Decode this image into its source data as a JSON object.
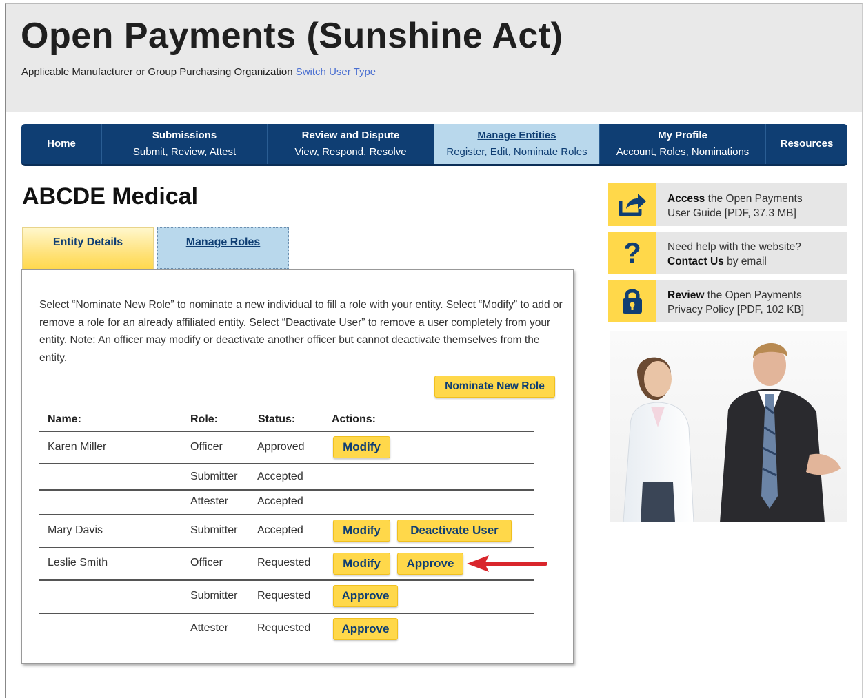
{
  "header": {
    "title": "Open Payments (Sunshine Act)",
    "user_type": "Applicable Manufacturer or Group Purchasing Organization",
    "switch_link": "Switch User Type"
  },
  "nav": [
    {
      "title": "Home",
      "subtitle": ""
    },
    {
      "title": "Submissions",
      "subtitle": "Submit, Review, Attest"
    },
    {
      "title": "Review and Dispute",
      "subtitle": "View, Respond, Resolve"
    },
    {
      "title": "Manage Entities",
      "subtitle": "Register, Edit, Nominate Roles"
    },
    {
      "title": "My Profile",
      "subtitle": "Account, Roles, Nominations"
    },
    {
      "title": "Resources",
      "subtitle": ""
    }
  ],
  "entity": {
    "name": "ABCDE Medical"
  },
  "tabs": {
    "entity_details": "Entity Details",
    "manage_roles": "Manage Roles"
  },
  "panel": {
    "instructions": "Select “Nominate New Role” to nominate a new individual to fill a role with your entity. Select “Modify” to add or remove a role for an already affiliated entity. Select “Deactivate User” to remove a user completely from your entity. Note: An officer may modify or deactivate another officer but cannot deactivate themselves from the entity.",
    "nominate_button": "Nominate New Role",
    "columns": [
      "Name:",
      "Role:",
      "Status:",
      "Actions:"
    ],
    "rows": [
      {
        "name": "Karen Miller",
        "role": "Officer",
        "status": "Approved",
        "actions": [
          "Modify"
        ]
      },
      {
        "name": "",
        "role": "Submitter",
        "status": "Accepted",
        "actions": []
      },
      {
        "name": "",
        "role": "Attester",
        "status": "Accepted",
        "actions": []
      },
      {
        "name": "Mary Davis",
        "role": "Submitter",
        "status": "Accepted",
        "actions": [
          "Modify",
          "Deactivate User"
        ]
      },
      {
        "name": "Leslie Smith",
        "role": "Officer",
        "status": "Requested",
        "actions": [
          "Modify",
          "Approve"
        ]
      },
      {
        "name": "",
        "role": "Submitter",
        "status": "Requested",
        "actions": [
          "Approve"
        ]
      },
      {
        "name": "",
        "role": "Attester",
        "status": "Requested",
        "actions": [
          "Approve"
        ]
      }
    ]
  },
  "sidebar": {
    "guide": {
      "bold": "Access",
      "text1": " the Open Payments",
      "text2": "User Guide [PDF, 37.3 MB]"
    },
    "help": {
      "text1": "Need help with the website?",
      "bold": "Contact Us",
      "text2": " by email"
    },
    "privacy": {
      "bold": "Review",
      "text1": " the Open Payments",
      "text2": "Privacy Policy [PDF, 102 KB]"
    }
  },
  "colors": {
    "nav_bg": "#0f3e73",
    "active_tab": "#b9d8ec",
    "button_yellow": "#ffd84a",
    "arrow_red": "#d9262c"
  },
  "icons": [
    "share-icon",
    "question-icon",
    "lock-icon"
  ]
}
